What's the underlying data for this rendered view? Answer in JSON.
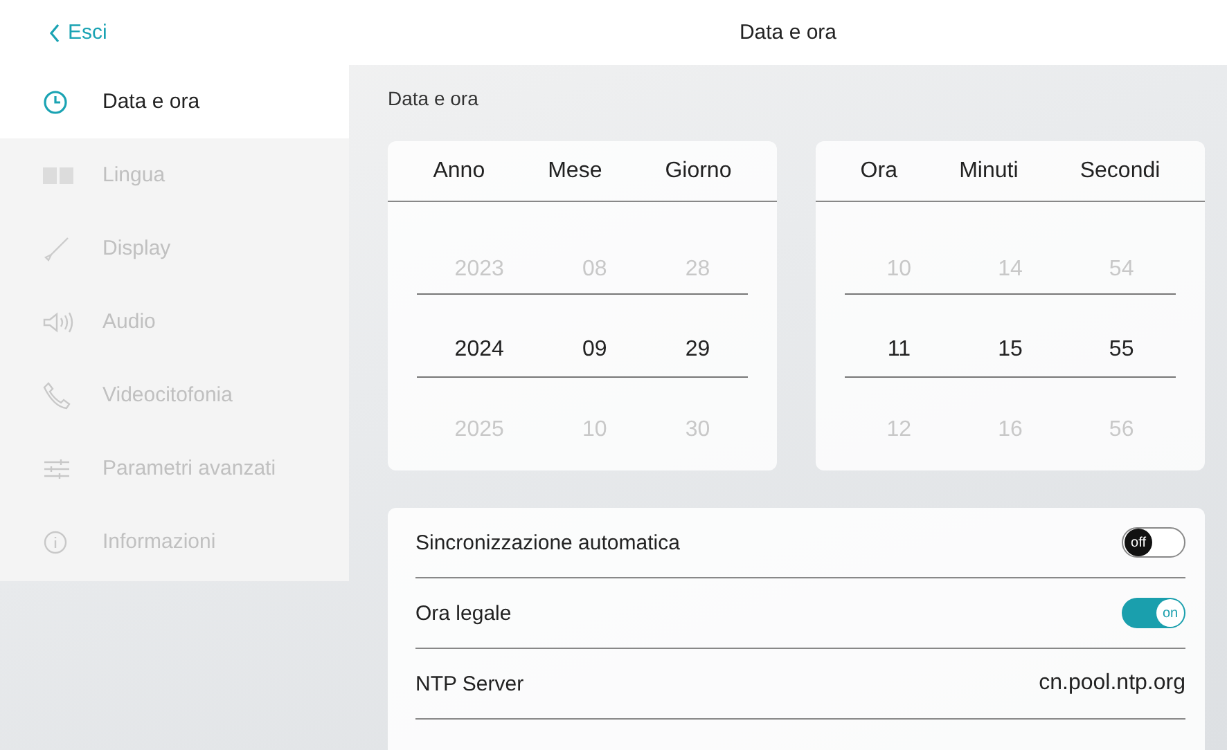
{
  "header": {
    "back": "Esci",
    "title": "Data e ora"
  },
  "sidebar": {
    "items": [
      {
        "label": "Data e ora",
        "kind": "clock",
        "selected": true
      },
      {
        "label": "Lingua",
        "kind": "language",
        "selected": false
      },
      {
        "label": "Display",
        "kind": "brush",
        "selected": false
      },
      {
        "label": "Audio",
        "kind": "speaker",
        "selected": false
      },
      {
        "label": "Videocitofonia",
        "kind": "phone",
        "selected": false
      },
      {
        "label": "Parametri avanzati",
        "kind": "sliders",
        "selected": false
      },
      {
        "label": "Informazioni",
        "kind": "info",
        "selected": false
      }
    ]
  },
  "section_title": "Data e ora",
  "pickers": [
    {
      "columns": [
        {
          "label": "Anno",
          "values": [
            "2023",
            "2024",
            "2025"
          ]
        },
        {
          "label": "Mese",
          "values": [
            "08",
            "09",
            "10"
          ]
        },
        {
          "label": "Giorno",
          "values": [
            "28",
            "29",
            "30"
          ]
        }
      ]
    },
    {
      "columns": [
        {
          "label": "Ora",
          "values": [
            "10",
            "11",
            "12"
          ]
        },
        {
          "label": "Minuti",
          "values": [
            "14",
            "15",
            "16"
          ]
        },
        {
          "label": "Secondi",
          "values": [
            "54",
            "55",
            "56"
          ]
        }
      ]
    }
  ],
  "settings": [
    {
      "kind": "toggle",
      "label": "Sincronizzazione automatica",
      "on": false,
      "switch_label": "off"
    },
    {
      "kind": "toggle",
      "label": "Ora legale",
      "on": true,
      "switch_label": "on"
    },
    {
      "kind": "value",
      "label": "NTP Server",
      "value": "cn.pool.ntp.org"
    }
  ]
}
